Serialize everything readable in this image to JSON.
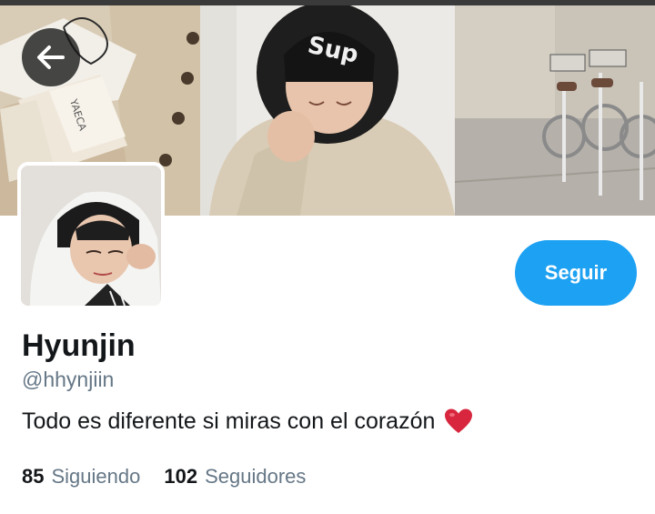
{
  "banner": {
    "images": [
      {
        "name": "knit-cardigan-and-socks-photo"
      },
      {
        "name": "person-in-hood-photo"
      },
      {
        "name": "parked-bicycles-photo"
      }
    ]
  },
  "nav": {
    "back_icon": "arrow-left-icon"
  },
  "profile": {
    "display_name": "Hyunjin",
    "handle": "@hhynjiin",
    "bio": "Todo es diferente si miras con el corazón",
    "bio_emoji": "heart-icon",
    "follow_label": "Seguir",
    "following_count": "85",
    "following_label": "Siguiendo",
    "followers_count": "102",
    "followers_label": "Seguidores"
  },
  "colors": {
    "accent": "#1da1f2",
    "text_primary": "#14171a",
    "text_secondary": "#657786",
    "heart": "#d7263d"
  }
}
